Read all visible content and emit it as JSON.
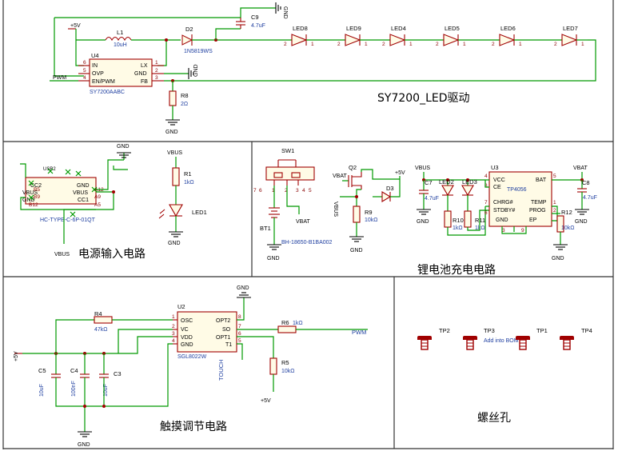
{
  "sections": {
    "led_driver": "SY7200_LED驱动",
    "power_input": "电源输入电路",
    "charger": "锂电池充电电路",
    "touch": "触摸调节电路",
    "screw_holes": "螺丝孔"
  },
  "led_driver": {
    "vcc": "+5V",
    "l1_ref": "L1",
    "l1_val": "10uH",
    "d2_ref": "D2",
    "d2_val": "1N5819WS",
    "c9_ref": "C9",
    "c9_val": "4.7uF",
    "u4_ref": "U4",
    "u4_val": "SY7200AABC",
    "u4_pins": {
      "in": "IN",
      "ovp": "OVP",
      "en": "EN/PWM",
      "lx": "LX",
      "gnd": "GND",
      "fb": "FB"
    },
    "u4_nums": {
      "in": "6",
      "ovp": "5",
      "en": "4",
      "lx": "1",
      "gnd": "2",
      "fb": "3"
    },
    "pwm": "PWM",
    "gnd": "GND",
    "r8_ref": "R8",
    "r8_val": "2Ω",
    "leds": [
      "LED8",
      "LED9",
      "LED4",
      "LED5",
      "LED6",
      "LED7"
    ],
    "pin1": "1",
    "pin2": "2"
  },
  "power_input": {
    "usb_ref": "USB2",
    "usb_val": "HC-TYPE-C-6P-01QT",
    "usb_pins": {
      "cc2": "CC2",
      "vbus_l": "VBUS",
      "gnd_l": "GND",
      "gnd_r": "GND",
      "vbus_r": "VBUS",
      "cc1": "CC1"
    },
    "usb_nums": {
      "b5": "B5",
      "b9": "B9",
      "b12": "B12",
      "a12": "A12",
      "a9": "A9",
      "a5": "A5"
    },
    "gnd": "GND",
    "vbus": "VBUS",
    "r1_ref": "R1",
    "r1_val": "1kΩ",
    "led1_ref": "LED1"
  },
  "charger": {
    "sw1_ref": "SW1",
    "sw_nums": [
      "7",
      "6",
      "1",
      "2",
      "3",
      "4",
      "5"
    ],
    "bt1_ref": "BT1",
    "bt_val": "BH-18650-B1BA002",
    "vbat": "VBAT",
    "gnd": "GND",
    "q2_ref": "Q2",
    "vbus": "VBUS",
    "plus5v": "+5V",
    "d3_ref": "D3",
    "r9_ref": "R9",
    "r9_val": "10kΩ",
    "c7_ref": "C7",
    "c7_val": "4.7uF",
    "led2_ref": "LED2",
    "led3_ref": "LED3",
    "r10_ref": "R10",
    "r10_val": "1kΩ",
    "r11_ref": "R11",
    "r11_val": "1kΩ",
    "u3_ref": "U3",
    "u3_val": "TP4056",
    "u3_pins": {
      "vcc": "VCC",
      "ce": "CE",
      "chrg": "CHRG#",
      "stdby": "STDBY#",
      "gnd": "GND",
      "bat": "BAT",
      "temp": "TEMP",
      "prog": "PROG",
      "ep": "EP"
    },
    "u3_nums": {
      "vcc": "4",
      "ce": "8",
      "chrg": "7",
      "stdby": "6",
      "bat": "5",
      "temp": "1",
      "prog": "2",
      "gnd": "3",
      "ep": "9"
    },
    "r12_ref": "R12",
    "r12_val": "10kΩ",
    "c8_ref": "C8",
    "c8_val": "4.7uF"
  },
  "touch": {
    "r4_ref": "R4",
    "r4_val": "47kΩ",
    "u2_ref": "U2",
    "u2_val": "SGL8022W",
    "u2_pins": {
      "osc": "OSC",
      "vc": "VC",
      "vdd": "VDD",
      "gnd": "GND",
      "opt2": "OPT2",
      "so": "SO",
      "opt1": "OPT1",
      "t1": "T1"
    },
    "u2_nums": {
      "osc": "1",
      "vc": "2",
      "vdd": "3",
      "gnd": "4",
      "opt2": "8",
      "so": "7",
      "opt1": "6",
      "t1": "5"
    },
    "gnd": "GND",
    "vcc": "+5V",
    "r6_ref": "R6",
    "r6_val": "1kΩ",
    "pwm": "PWM",
    "touch_net": "TOUCH",
    "r5_ref": "R5",
    "r5_val": "10kΩ",
    "c5_ref": "C5",
    "c5_val": "10uF",
    "c4_ref": "C4",
    "c4_val": "100nF",
    "c3_ref": "C3",
    "c3_val": "10uF"
  },
  "screws": {
    "labels": [
      "TP2",
      "TP3",
      "TP1",
      "TP4"
    ],
    "note": "Add into BOM"
  }
}
